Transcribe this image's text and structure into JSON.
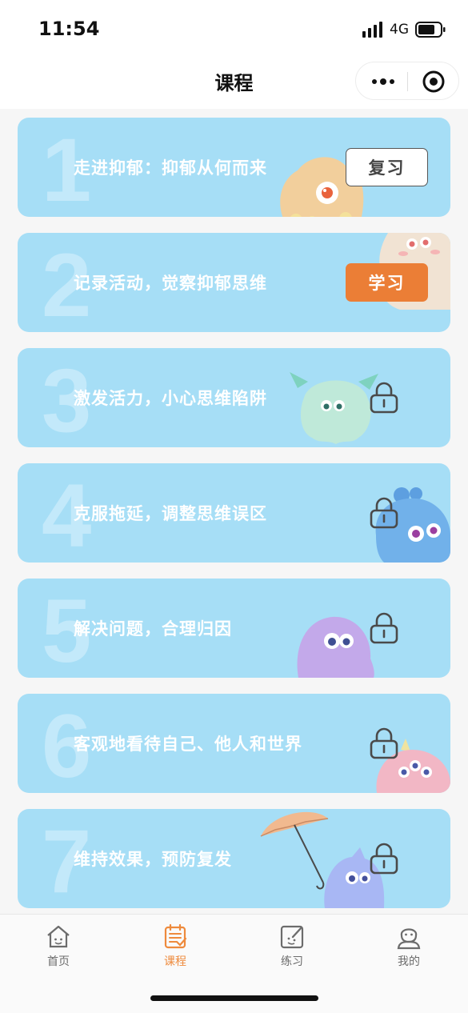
{
  "status_bar": {
    "time": "11:54",
    "network": "4G"
  },
  "nav": {
    "title": "课程"
  },
  "courses": [
    {
      "number": "1",
      "title": "走进抑郁：抑郁从何而来",
      "action": "复习",
      "locked": false
    },
    {
      "number": "2",
      "title": "记录活动，觉察抑郁思维",
      "action": "学习",
      "locked": false
    },
    {
      "number": "3",
      "title": "激发活力，小心思维陷阱",
      "action": "",
      "locked": true
    },
    {
      "number": "4",
      "title": "克服拖延，调整思维误区",
      "action": "",
      "locked": true
    },
    {
      "number": "5",
      "title": "解决问题，合理归因",
      "action": "",
      "locked": true
    },
    {
      "number": "6",
      "title": "客观地看待自己、他人和世界",
      "action": "",
      "locked": true
    },
    {
      "number": "7",
      "title": "维持效果，预防复发",
      "action": "",
      "locked": true
    }
  ],
  "tabs": [
    {
      "label": "首页",
      "icon": "home-icon",
      "active": false
    },
    {
      "label": "课程",
      "icon": "course-icon",
      "active": true
    },
    {
      "label": "练习",
      "icon": "practice-icon",
      "active": false
    },
    {
      "label": "我的",
      "icon": "profile-icon",
      "active": false
    }
  ],
  "colors": {
    "card": "#a6def6",
    "card_number": "#c3e9fa",
    "study_button": "#eb7e36",
    "active_tab": "#ee8a3c"
  }
}
